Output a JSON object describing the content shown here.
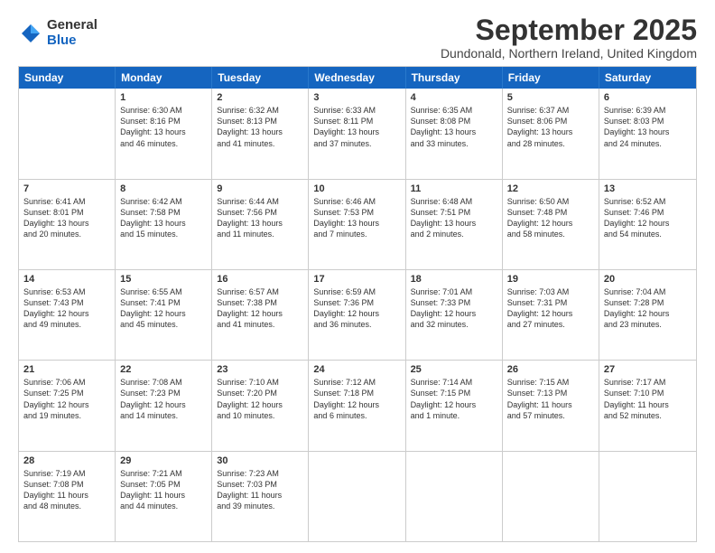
{
  "logo": {
    "general": "General",
    "blue": "Blue"
  },
  "title": "September 2025",
  "subtitle": "Dundonald, Northern Ireland, United Kingdom",
  "days": [
    "Sunday",
    "Monday",
    "Tuesday",
    "Wednesday",
    "Thursday",
    "Friday",
    "Saturday"
  ],
  "weeks": [
    [
      {
        "day": "",
        "lines": []
      },
      {
        "day": "1",
        "lines": [
          "Sunrise: 6:30 AM",
          "Sunset: 8:16 PM",
          "Daylight: 13 hours",
          "and 46 minutes."
        ]
      },
      {
        "day": "2",
        "lines": [
          "Sunrise: 6:32 AM",
          "Sunset: 8:13 PM",
          "Daylight: 13 hours",
          "and 41 minutes."
        ]
      },
      {
        "day": "3",
        "lines": [
          "Sunrise: 6:33 AM",
          "Sunset: 8:11 PM",
          "Daylight: 13 hours",
          "and 37 minutes."
        ]
      },
      {
        "day": "4",
        "lines": [
          "Sunrise: 6:35 AM",
          "Sunset: 8:08 PM",
          "Daylight: 13 hours",
          "and 33 minutes."
        ]
      },
      {
        "day": "5",
        "lines": [
          "Sunrise: 6:37 AM",
          "Sunset: 8:06 PM",
          "Daylight: 13 hours",
          "and 28 minutes."
        ]
      },
      {
        "day": "6",
        "lines": [
          "Sunrise: 6:39 AM",
          "Sunset: 8:03 PM",
          "Daylight: 13 hours",
          "and 24 minutes."
        ]
      }
    ],
    [
      {
        "day": "7",
        "lines": [
          "Sunrise: 6:41 AM",
          "Sunset: 8:01 PM",
          "Daylight: 13 hours",
          "and 20 minutes."
        ]
      },
      {
        "day": "8",
        "lines": [
          "Sunrise: 6:42 AM",
          "Sunset: 7:58 PM",
          "Daylight: 13 hours",
          "and 15 minutes."
        ]
      },
      {
        "day": "9",
        "lines": [
          "Sunrise: 6:44 AM",
          "Sunset: 7:56 PM",
          "Daylight: 13 hours",
          "and 11 minutes."
        ]
      },
      {
        "day": "10",
        "lines": [
          "Sunrise: 6:46 AM",
          "Sunset: 7:53 PM",
          "Daylight: 13 hours",
          "and 7 minutes."
        ]
      },
      {
        "day": "11",
        "lines": [
          "Sunrise: 6:48 AM",
          "Sunset: 7:51 PM",
          "Daylight: 13 hours",
          "and 2 minutes."
        ]
      },
      {
        "day": "12",
        "lines": [
          "Sunrise: 6:50 AM",
          "Sunset: 7:48 PM",
          "Daylight: 12 hours",
          "and 58 minutes."
        ]
      },
      {
        "day": "13",
        "lines": [
          "Sunrise: 6:52 AM",
          "Sunset: 7:46 PM",
          "Daylight: 12 hours",
          "and 54 minutes."
        ]
      }
    ],
    [
      {
        "day": "14",
        "lines": [
          "Sunrise: 6:53 AM",
          "Sunset: 7:43 PM",
          "Daylight: 12 hours",
          "and 49 minutes."
        ]
      },
      {
        "day": "15",
        "lines": [
          "Sunrise: 6:55 AM",
          "Sunset: 7:41 PM",
          "Daylight: 12 hours",
          "and 45 minutes."
        ]
      },
      {
        "day": "16",
        "lines": [
          "Sunrise: 6:57 AM",
          "Sunset: 7:38 PM",
          "Daylight: 12 hours",
          "and 41 minutes."
        ]
      },
      {
        "day": "17",
        "lines": [
          "Sunrise: 6:59 AM",
          "Sunset: 7:36 PM",
          "Daylight: 12 hours",
          "and 36 minutes."
        ]
      },
      {
        "day": "18",
        "lines": [
          "Sunrise: 7:01 AM",
          "Sunset: 7:33 PM",
          "Daylight: 12 hours",
          "and 32 minutes."
        ]
      },
      {
        "day": "19",
        "lines": [
          "Sunrise: 7:03 AM",
          "Sunset: 7:31 PM",
          "Daylight: 12 hours",
          "and 27 minutes."
        ]
      },
      {
        "day": "20",
        "lines": [
          "Sunrise: 7:04 AM",
          "Sunset: 7:28 PM",
          "Daylight: 12 hours",
          "and 23 minutes."
        ]
      }
    ],
    [
      {
        "day": "21",
        "lines": [
          "Sunrise: 7:06 AM",
          "Sunset: 7:25 PM",
          "Daylight: 12 hours",
          "and 19 minutes."
        ]
      },
      {
        "day": "22",
        "lines": [
          "Sunrise: 7:08 AM",
          "Sunset: 7:23 PM",
          "Daylight: 12 hours",
          "and 14 minutes."
        ]
      },
      {
        "day": "23",
        "lines": [
          "Sunrise: 7:10 AM",
          "Sunset: 7:20 PM",
          "Daylight: 12 hours",
          "and 10 minutes."
        ]
      },
      {
        "day": "24",
        "lines": [
          "Sunrise: 7:12 AM",
          "Sunset: 7:18 PM",
          "Daylight: 12 hours",
          "and 6 minutes."
        ]
      },
      {
        "day": "25",
        "lines": [
          "Sunrise: 7:14 AM",
          "Sunset: 7:15 PM",
          "Daylight: 12 hours",
          "and 1 minute."
        ]
      },
      {
        "day": "26",
        "lines": [
          "Sunrise: 7:15 AM",
          "Sunset: 7:13 PM",
          "Daylight: 11 hours",
          "and 57 minutes."
        ]
      },
      {
        "day": "27",
        "lines": [
          "Sunrise: 7:17 AM",
          "Sunset: 7:10 PM",
          "Daylight: 11 hours",
          "and 52 minutes."
        ]
      }
    ],
    [
      {
        "day": "28",
        "lines": [
          "Sunrise: 7:19 AM",
          "Sunset: 7:08 PM",
          "Daylight: 11 hours",
          "and 48 minutes."
        ]
      },
      {
        "day": "29",
        "lines": [
          "Sunrise: 7:21 AM",
          "Sunset: 7:05 PM",
          "Daylight: 11 hours",
          "and 44 minutes."
        ]
      },
      {
        "day": "30",
        "lines": [
          "Sunrise: 7:23 AM",
          "Sunset: 7:03 PM",
          "Daylight: 11 hours",
          "and 39 minutes."
        ]
      },
      {
        "day": "",
        "lines": []
      },
      {
        "day": "",
        "lines": []
      },
      {
        "day": "",
        "lines": []
      },
      {
        "day": "",
        "lines": []
      }
    ]
  ]
}
